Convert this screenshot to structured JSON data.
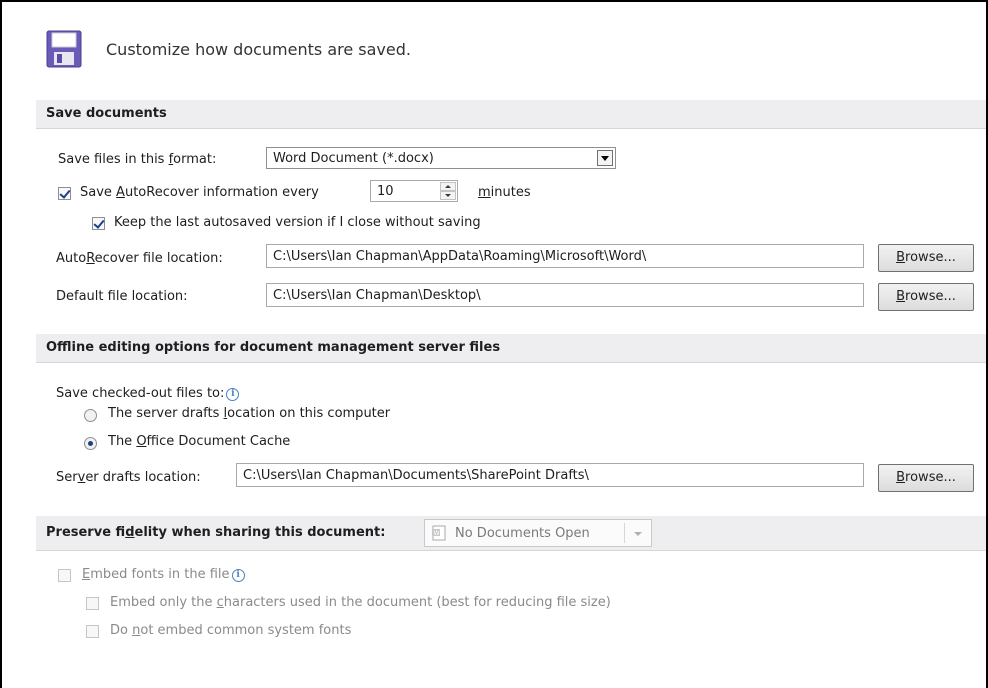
{
  "header": {
    "title": "Customize how documents are saved.",
    "icon": "floppy-disk-icon"
  },
  "save_documents": {
    "section_title": "Save documents",
    "format_label_pre": "Save files in this ",
    "format_label_u": "f",
    "format_label_post": "ormat:",
    "format_value": "Word Document (*.docx)",
    "autorecover_pre": "Save ",
    "autorecover_u": "A",
    "autorecover_post": "utoRecover information every",
    "autorecover_checked": true,
    "autorecover_minutes": "10",
    "minutes_u": "m",
    "minutes_post": "inutes",
    "keep_last": "Keep the last autosaved version if I close without saving",
    "keep_last_checked": true,
    "ar_location_pre": "Auto",
    "ar_location_u": "R",
    "ar_location_post": "ecover file location:",
    "ar_location_value": "C:\\Users\\Ian Chapman\\AppData\\Roaming\\Microsoft\\Word\\",
    "default_location_pre": "Default f",
    "default_location_u": "i",
    "default_location_post": "le location:",
    "default_location_value": "C:\\Users\\Ian Chapman\\Desktop\\",
    "browse_u": "B",
    "browse_post": "rowse..."
  },
  "offline": {
    "section_title": "Offline editing options for document management server files",
    "checked_out_label": "Save checked-out files to:",
    "radio_server_pre": "The server drafts ",
    "radio_server_u": "l",
    "radio_server_post": "ocation on this computer",
    "radio_cache_pre": "The ",
    "radio_cache_u": "O",
    "radio_cache_post": "ffice Document Cache",
    "selected": "cache",
    "server_drafts_pre": "Ser",
    "server_drafts_u": "v",
    "server_drafts_post": "er drafts location:",
    "server_drafts_value": "C:\\Users\\Ian Chapman\\Documents\\SharePoint Drafts\\",
    "browse_u": "B",
    "browse_post": "rowse..."
  },
  "fidelity": {
    "section_pre": "Preserve fi",
    "section_u": "d",
    "section_post": "elity when sharing this document:",
    "doc_value": "No Documents Open",
    "embed_fonts_u": "E",
    "embed_fonts_post": "mbed fonts in the file",
    "embed_only_pre": "Embed only the ",
    "embed_only_u": "c",
    "embed_only_post": "haracters used in the document (best for reducing file size)",
    "no_common_pre": "Do ",
    "no_common_u": "n",
    "no_common_post": "ot embed common system fonts"
  },
  "colors": {
    "section_bg": "#eeeef0",
    "check_blue": "#1b3e8e",
    "info_blue": "#4a7ec4"
  }
}
